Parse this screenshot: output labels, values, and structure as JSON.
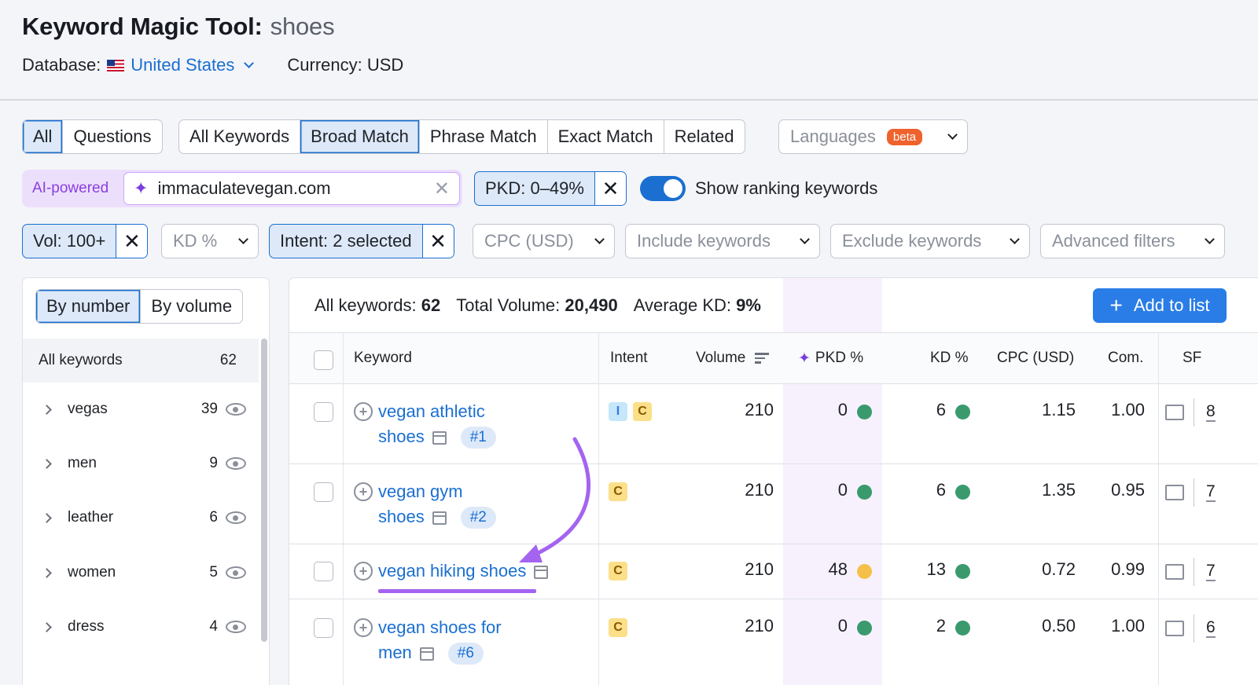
{
  "header": {
    "title": "Keyword Magic Tool:",
    "query": "shoes",
    "database_label": "Database:",
    "database_value": "United States",
    "currency": "Currency: USD"
  },
  "tabs_scope": [
    "All",
    "Questions"
  ],
  "tabs_match": [
    "All Keywords",
    "Broad Match",
    "Phrase Match",
    "Exact Match",
    "Related"
  ],
  "languages": {
    "label": "Languages",
    "badge": "beta"
  },
  "ai": {
    "label": "AI-powered",
    "domain": "immaculatevegan.com"
  },
  "pkd_chip": "PKD: 0–49%",
  "toggle_label": "Show ranking keywords",
  "filters": {
    "vol": "Vol: 100+",
    "kd": "KD %",
    "intent": "Intent: 2 selected",
    "cpc": "CPC (USD)",
    "include": "Include keywords",
    "exclude": "Exclude keywords",
    "advanced": "Advanced filters"
  },
  "left_panel": {
    "tabs": [
      "By number",
      "By volume"
    ],
    "all_label": "All keywords",
    "all_count": "62",
    "groups": [
      {
        "name": "vegas",
        "count": "39"
      },
      {
        "name": "men",
        "count": "9"
      },
      {
        "name": "leather",
        "count": "6"
      },
      {
        "name": "women",
        "count": "5"
      },
      {
        "name": "dress",
        "count": "4"
      }
    ]
  },
  "stats": {
    "all_label": "All keywords:",
    "all_value": "62",
    "volume_label": "Total Volume:",
    "volume_value": "20,490",
    "kd_label": "Average KD:",
    "kd_value": "9%"
  },
  "add_button": "Add to list",
  "columns": [
    "Keyword",
    "Intent",
    "Volume",
    "PKD %",
    "KD %",
    "CPC (USD)",
    "Com.",
    "SF"
  ],
  "rows": [
    {
      "line1": "vegan athletic",
      "line2": "shoes",
      "rank": "#1",
      "intents": [
        "I",
        "C"
      ],
      "volume": "210",
      "pkd": "0",
      "kd": "6",
      "cpc": "1.15",
      "com": "1.00",
      "sf": "8"
    },
    {
      "line1": "vegan gym",
      "line2": "shoes",
      "rank": "#2",
      "intents": [
        "C"
      ],
      "volume": "210",
      "pkd": "0",
      "kd": "6",
      "cpc": "1.35",
      "com": "0.95",
      "sf": "7"
    },
    {
      "line1": "vegan hiking shoes",
      "line2": "",
      "rank": "",
      "intents": [
        "C"
      ],
      "volume": "210",
      "pkd": "48",
      "kd": "13",
      "cpc": "0.72",
      "com": "0.99",
      "sf": "7"
    },
    {
      "line1": "vegan shoes for",
      "line2": "men",
      "rank": "#6",
      "intents": [
        "C"
      ],
      "volume": "210",
      "pkd": "0",
      "kd": "2",
      "cpc": "0.50",
      "com": "1.00",
      "sf": "6"
    }
  ],
  "colors": {
    "accent": "#1a6fd1",
    "green": "#3a9a6e",
    "yellow": "#f5c04a",
    "purple": "#a464f0"
  }
}
